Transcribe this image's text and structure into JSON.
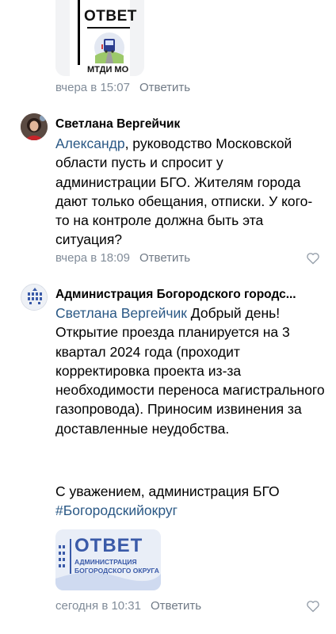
{
  "comment1": {
    "image": {
      "title": "ОТВЕТ",
      "caption": "МТДИ МО"
    },
    "time": "вчера в 15:07",
    "reply_label": "Ответить"
  },
  "comment2": {
    "author": "Светлана Вергейчик",
    "mention": "Александр",
    "text": ", руководство Московской области пусть и спросит у администрации БГО. Жителям города дают только обещания, отписки. У кого-то на контроле должна быть эта ситуация?",
    "time": "вчера в 18:09",
    "reply_label": "Ответить"
  },
  "comment3": {
    "author": "Администрация Богородского городс...",
    "mention": "Светлана Вергейчик",
    "text": " Добрый день! Открытие проезда планируется на 3 квартал 2024 года (проходит корректировка проекта из-за необходимости переноса магистрального газопровода). Приносим извинения за доставленные неудобства.",
    "signature": "С уважением, администрация БГО",
    "hashtag": "#Богородскийокруг",
    "image": {
      "title": "ОТВЕТ",
      "subtitle_line1": "АДМИНИСТРАЦИЯ",
      "subtitle_line2": "БОГОРОДСКОГО ОКРУГА"
    },
    "time": "сегодня в 10:31",
    "reply_label": "Ответить"
  },
  "colors": {
    "link": "#2a5885",
    "meta": "#818c99",
    "accent_blue": "#3a5aa8"
  }
}
